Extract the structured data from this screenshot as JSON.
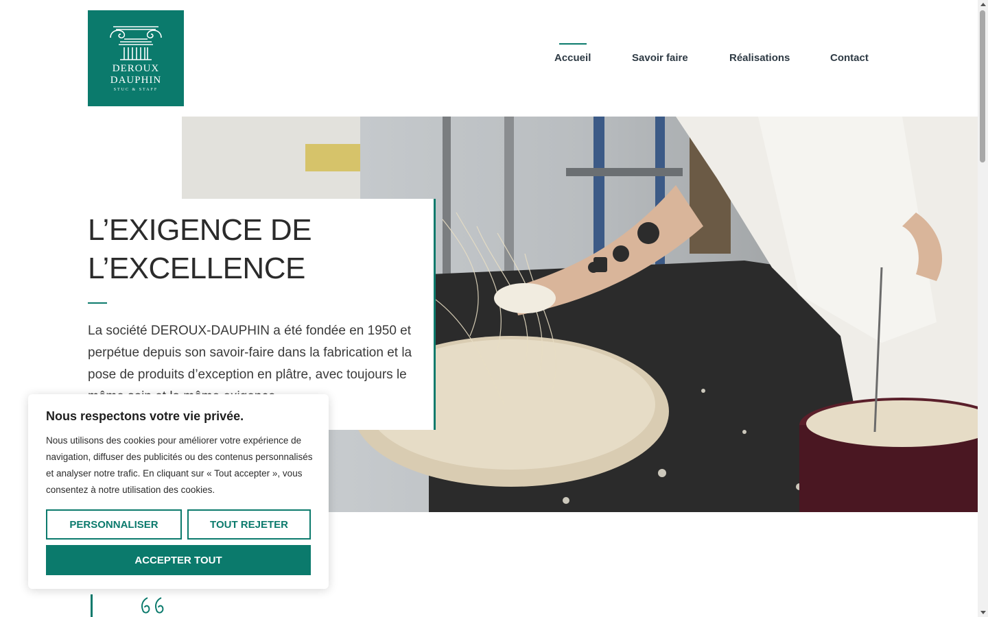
{
  "brand": {
    "logo_line1": "DEROUX",
    "logo_line2": "DAUPHIN",
    "logo_line3": "STUC & STAFF",
    "color_primary": "#0b7a6c"
  },
  "nav": {
    "items": [
      {
        "label": "Accueil",
        "active": true
      },
      {
        "label": "Savoir faire",
        "active": false
      },
      {
        "label": "Réalisations",
        "active": false
      },
      {
        "label": "Contact",
        "active": false
      }
    ]
  },
  "hero": {
    "title_line1": "L’EXIGENCE DE",
    "title_line2": "L’EXCELLENCE",
    "text": "La société DEROUX-DAUPHIN a été fondée en 1950 et perpétue depuis son savoir-faire dans la fabrication et la pose de produits d’exception en plâtre, avec toujours le même soin et la même exigence."
  },
  "cookie": {
    "title": "Nous respectons votre vie privée.",
    "body": "Nous utilisons des cookies pour améliorer votre expérience de navigation, diffuser des publicités ou des contenus personnalisés et analyser notre trafic. En cliquant sur « Tout accepter », vous consentez à notre utilisation des cookies.",
    "btn_customize": "PERSONNALISER",
    "btn_reject": "TOUT REJETER",
    "btn_accept": "ACCEPTER TOUT"
  }
}
